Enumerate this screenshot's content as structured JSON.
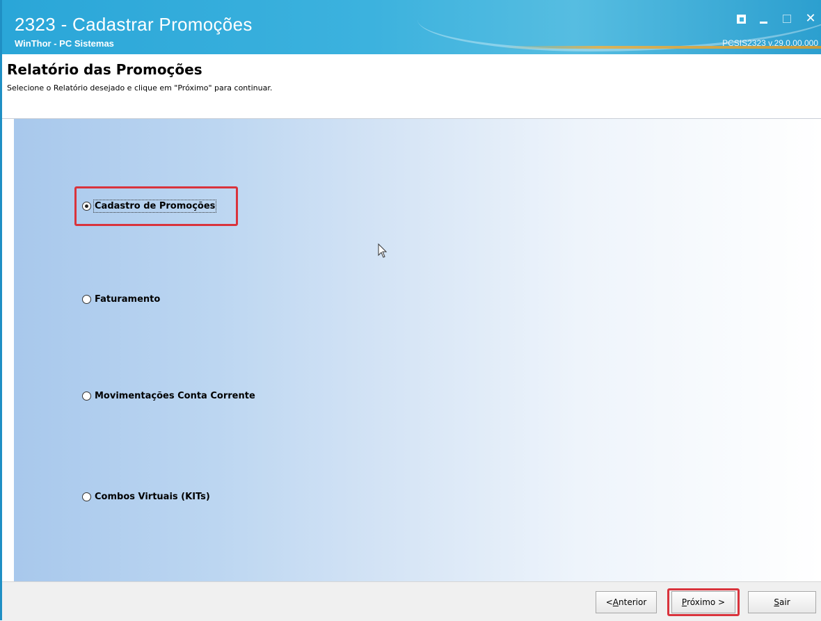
{
  "window": {
    "title": "2323 - Cadastrar Promoções",
    "subtitle": "WinThor - PC Sistemas",
    "version": "PCSIS2323  v.29.0.00.000",
    "controls": [
      "restore-icon",
      "minimize-icon",
      "maximize-icon",
      "close-icon"
    ],
    "close_glyph": "✕"
  },
  "header": {
    "title": "Relatório das Promoções",
    "instruction": "Selecione o Relatório desejado e clique em \"Próximo\" para continuar."
  },
  "report_options": {
    "selected": "Cadastro de Promoções",
    "items": [
      {
        "label": "Cadastro de Promoções",
        "checked": true
      },
      {
        "label": "Faturamento",
        "checked": false
      },
      {
        "label": "Movimentações Conta Corrente",
        "checked": false
      },
      {
        "label": "Combos Virtuais (KITs)",
        "checked": false
      }
    ]
  },
  "footer": {
    "prev_prefix": "< ",
    "prev_accel": "A",
    "prev_rest": "nterior",
    "next_accel": "P",
    "next_rest": "róximo >",
    "exit_accel": "S",
    "exit_rest": "air"
  },
  "colors": {
    "titlebar": "#3cb2de",
    "highlight": "#d9333c",
    "panel_gradient_start": "#a8c8ec"
  }
}
